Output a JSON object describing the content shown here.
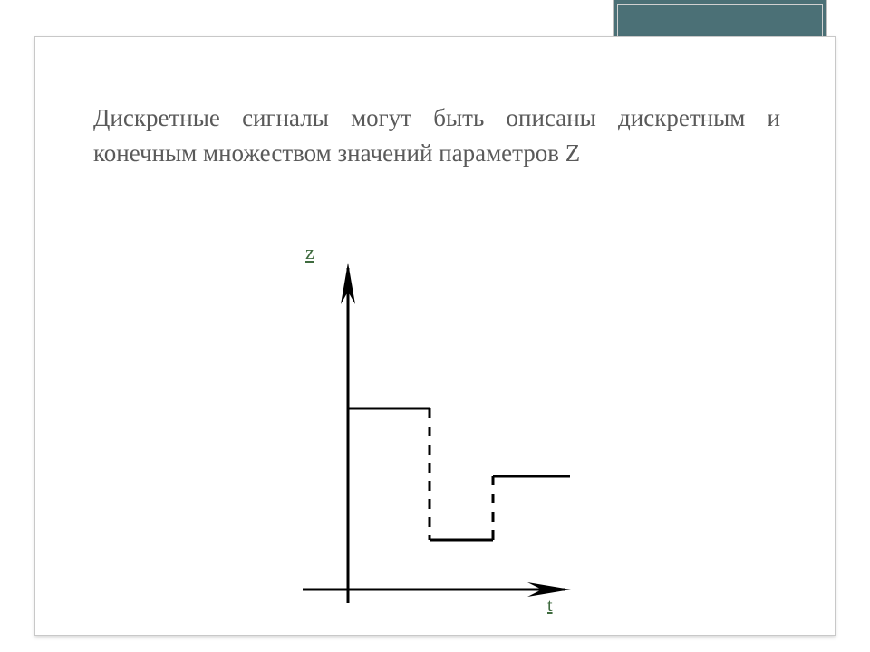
{
  "text": {
    "paragraph": "Дискретные сигналы могут быть описаны дискретным и конечным множеством значений параметров Z"
  },
  "axes": {
    "y_label": "z",
    "x_label": "t"
  },
  "chart_data": {
    "type": "line",
    "title": "",
    "xlabel": "t",
    "ylabel": "z",
    "x": [
      0,
      1,
      2,
      3
    ],
    "values": [
      2,
      0.5,
      1.2,
      1.2
    ],
    "note": "Step (staircase) discrete-signal sketch. Solid horizontal levels at each interval; dashed vertical drops between levels. Axis ticks not numbered in the source image — values are approximate levels."
  },
  "colors": {
    "teal": "#4b7076",
    "text": "#5a5a5a",
    "axis_label": "#3f6b3f"
  }
}
